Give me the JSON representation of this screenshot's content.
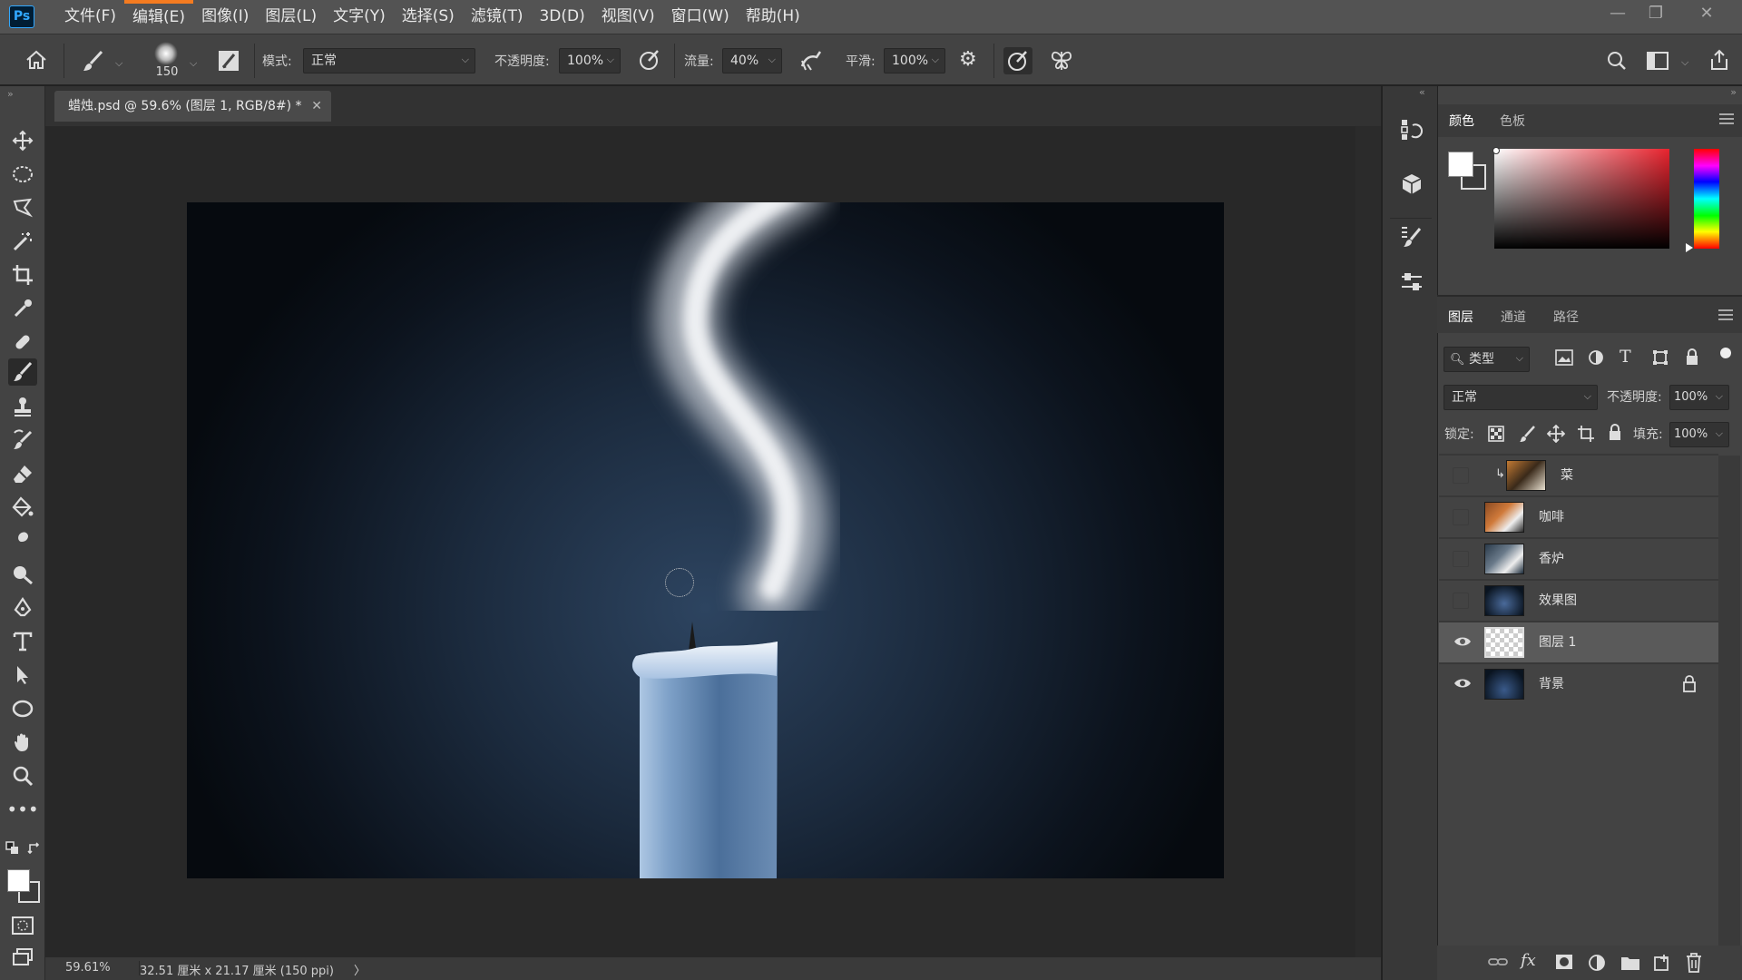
{
  "app": {
    "logo": "Ps"
  },
  "menu": [
    "文件(F)",
    "编辑(E)",
    "图像(I)",
    "图层(L)",
    "文字(Y)",
    "选择(S)",
    "滤镜(T)",
    "3D(D)",
    "视图(V)",
    "窗口(W)",
    "帮助(H)"
  ],
  "options": {
    "brush_size": "150",
    "mode_label": "模式:",
    "mode_value": "正常",
    "opacity_label": "不透明度:",
    "opacity_value": "100%",
    "flow_label": "流量:",
    "flow_value": "40%",
    "smoothing_label": "平滑:",
    "smoothing_value": "100%"
  },
  "document": {
    "tab_title": "蜡烛.psd @ 59.6% (图层 1, RGB/8#) *",
    "zoom": "59.61%",
    "dimensions": "32.51 厘米 x 21.17 厘米 (150 ppi)",
    "status_arrow": "〉"
  },
  "color_panel": {
    "tabs": [
      "颜色",
      "色板"
    ],
    "fg_color": "#ffffff",
    "bg_color": "#3a3a3a"
  },
  "layers_panel": {
    "tabs": [
      "图层",
      "通道",
      "路径"
    ],
    "filter_label": "类型",
    "blend_mode": "正常",
    "opacity_label": "不透明度:",
    "opacity_value": "100%",
    "lock_label": "锁定:",
    "fill_label": "填充:",
    "fill_value": "100%",
    "layers": [
      {
        "name": "菜",
        "visible": false,
        "clipped": true
      },
      {
        "name": "咖啡",
        "visible": false,
        "clipped": false
      },
      {
        "name": "香炉",
        "visible": false,
        "clipped": false
      },
      {
        "name": "效果图",
        "visible": false,
        "clipped": false
      },
      {
        "name": "图层 1",
        "visible": true,
        "selected": true
      },
      {
        "name": "背景",
        "visible": true,
        "locked": true
      }
    ]
  },
  "colors": {
    "accent": "#31a8ff",
    "menu_highlight": "#f47b20",
    "panel_bg": "#434343",
    "selected_layer": "#5a5a5a"
  }
}
